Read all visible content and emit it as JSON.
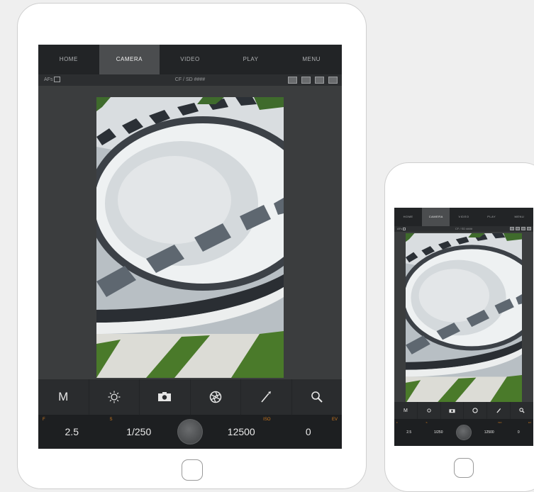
{
  "nav": {
    "tabs": [
      {
        "label": "HOME"
      },
      {
        "label": "CAMERA"
      },
      {
        "label": "VIDEO"
      },
      {
        "label": "PLAY"
      },
      {
        "label": "MENU"
      }
    ],
    "active_index": 1
  },
  "status": {
    "af_label": "AFs",
    "storage": "CF / SD ####"
  },
  "controls": {
    "mode_label": "M",
    "aperture_tag": "F",
    "aperture_value": "2.5",
    "shutter_tag": "S",
    "shutter_value": "1/250",
    "iso_tag": "ISO",
    "iso_value": "12500",
    "ev_tag": "EV",
    "ev_value": "0"
  },
  "colors": {
    "accent": "#d07a1e",
    "active_tab": "#4b4d4f",
    "screen_bg": "#3b3d3e"
  }
}
